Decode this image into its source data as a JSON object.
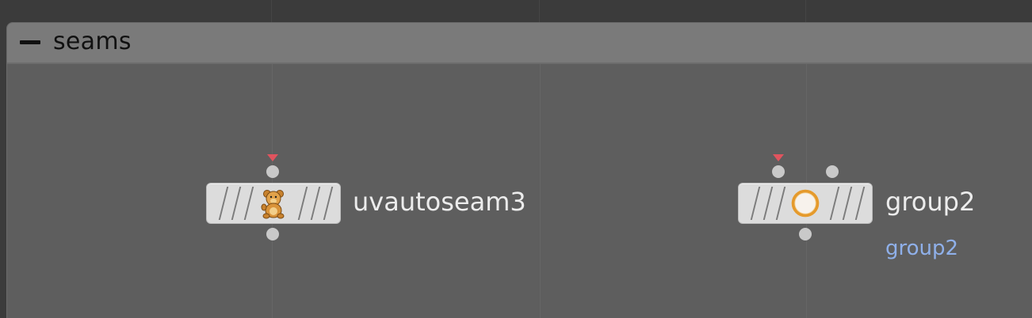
{
  "network_box": {
    "title": "seams"
  },
  "nodes": [
    {
      "name": "uvautoseam3",
      "icon": "teddy-bear-icon",
      "display_flag": true
    },
    {
      "name": "group2",
      "icon": "circle-ring-icon",
      "display_flag": true,
      "comment": "group2"
    }
  ],
  "colors": {
    "canvas_bg": "#3b3b3b",
    "netbox_bg": "#5e5e5e",
    "netbox_header_bg": "#7a7a7a",
    "node_bg": "#dcdcdc",
    "node_label": "#ececec",
    "comment_label": "#8fb0ea",
    "display_flag": "#e0545e",
    "connector": "#c9c9c9"
  }
}
